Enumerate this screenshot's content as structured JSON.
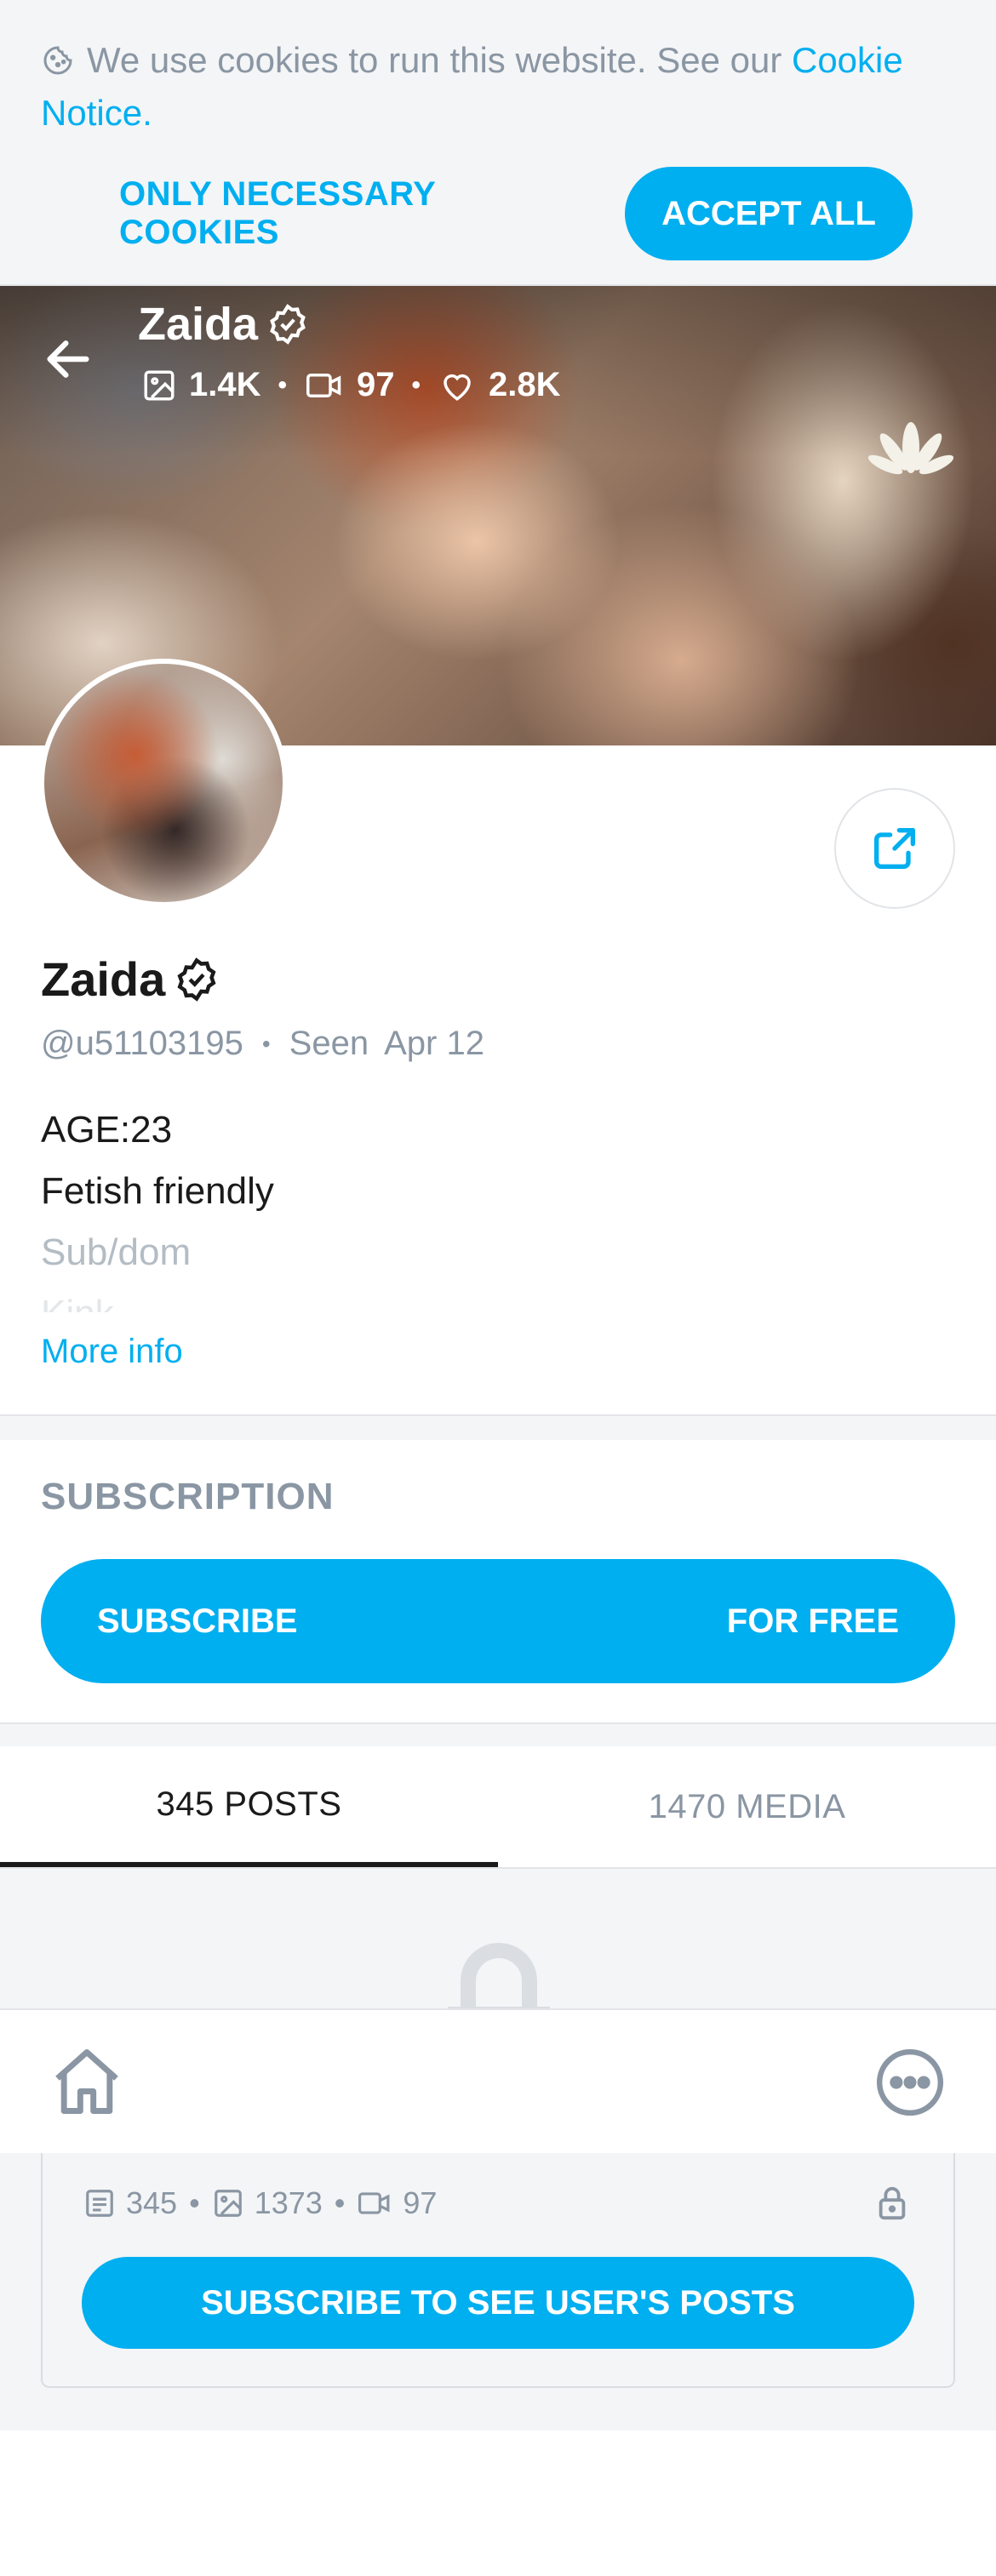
{
  "cookie": {
    "text": "We use cookies to run this website. See our ",
    "link": "Cookie Notice",
    "after": ".",
    "necessary_label": "ONLY NECESSARY COOKIES",
    "accept_label": "ACCEPT ALL"
  },
  "profile": {
    "name": "Zaida",
    "handle": "@u51103195",
    "seen_label": "Seen",
    "seen_date": "Apr 12",
    "stats": {
      "photos": "1.4K",
      "videos": "97",
      "likes": "2.8K"
    },
    "bio": [
      "AGE:23",
      "Fetish friendly",
      "Sub/dom",
      "Kink"
    ],
    "more_info": "More info"
  },
  "subscription": {
    "title": "SUBSCRIPTION",
    "button_left": "SUBSCRIBE",
    "button_right": "FOR FREE"
  },
  "tabs": {
    "posts": "345 POSTS",
    "media": "1470 MEDIA"
  },
  "locked_card": {
    "posts": "345",
    "photos": "1373",
    "videos": "97",
    "button": "SUBSCRIBE TO SEE USER'S POSTS"
  },
  "colors": {
    "accent": "#00aff0",
    "muted": "#8a96a3",
    "bg_gray": "#f4f5f7"
  },
  "icons": [
    "cookie-icon",
    "back-arrow-icon",
    "verified-icon",
    "image-icon",
    "video-icon",
    "heart-icon",
    "share-icon",
    "lock-icon",
    "home-icon",
    "more-icon",
    "post-icon"
  ]
}
